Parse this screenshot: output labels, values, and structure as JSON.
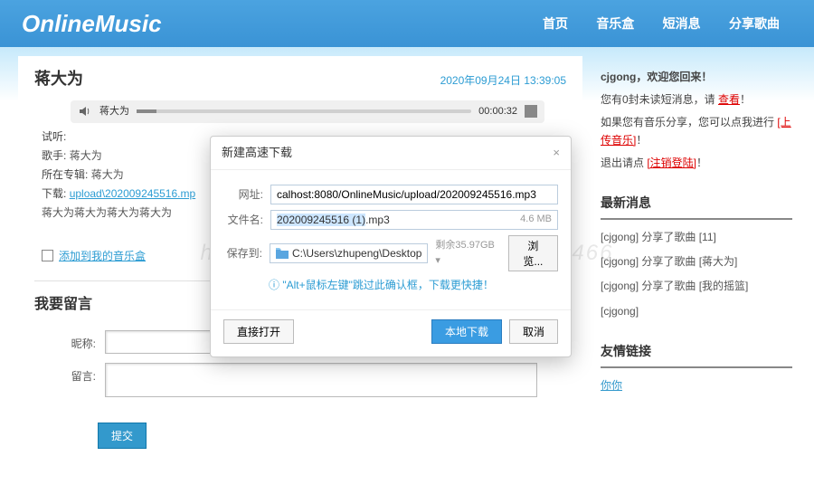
{
  "header": {
    "logo": "OnlineMusic",
    "nav": [
      "首页",
      "音乐盒",
      "短消息",
      "分享歌曲"
    ]
  },
  "song": {
    "title": "蒋大为",
    "timestamp": "2020年09月24日 13:39:05",
    "player_name": "蒋大为",
    "player_time": "00:00:32",
    "listen_label": "试听:",
    "artist_label": "歌手:",
    "artist": "蒋大为",
    "album_label": "所在专辑:",
    "album": "蒋大为",
    "download_label": "下载:",
    "download_link": "upload\\202009245516.mp",
    "desc": "蒋大为蒋大为蒋大为蒋大为",
    "add_to_box": "添加到我的音乐盒"
  },
  "comment": {
    "heading": "我要留言",
    "nick_label": "昵称:",
    "msg_label": "留言:",
    "submit": "提交"
  },
  "side": {
    "welcome": "cjgong，欢迎您回来！",
    "line1a": "您有0封未读短消息，请 ",
    "line1b": "查看",
    "line1c": "！",
    "line2a": "如果您有音乐分享，您可以点我进行 ",
    "line2b": "[上传音乐]",
    "line2c": "！",
    "line3a": "退出请点 ",
    "line3b": "[注销登陆]",
    "line3c": "！",
    "news_h": "最新消息",
    "news": [
      "[cjgong] 分享了歌曲 [11]",
      "[cjgong] 分享了歌曲 [蒋大为]",
      "[cjgong] 分享了歌曲 [我的摇篮]",
      "[cjgong]"
    ],
    "links_h": "友情链接",
    "link1": "你你"
  },
  "dialog": {
    "title": "新建高速下载",
    "url_label": "网址:",
    "url": "calhost:8080/OnlineMusic/upload/202009245516.mp3",
    "name_label": "文件名:",
    "file_name_sel": "202009245516 (1)",
    "file_name_ext": ".mp3",
    "size": "4.6 MB",
    "save_label": "保存到:",
    "save_path": "C:\\Users\\zhupeng\\Desktop",
    "remain": "剩余35.97GB ▾",
    "browse": "浏览...",
    "hint": "\"Alt+鼠标左键\"跳过此确认框，下载更快捷！",
    "open": "直接打开",
    "download": "本地下载",
    "cancel": "取消"
  },
  "watermark": "https://www.huzhan.com/ishop33466"
}
